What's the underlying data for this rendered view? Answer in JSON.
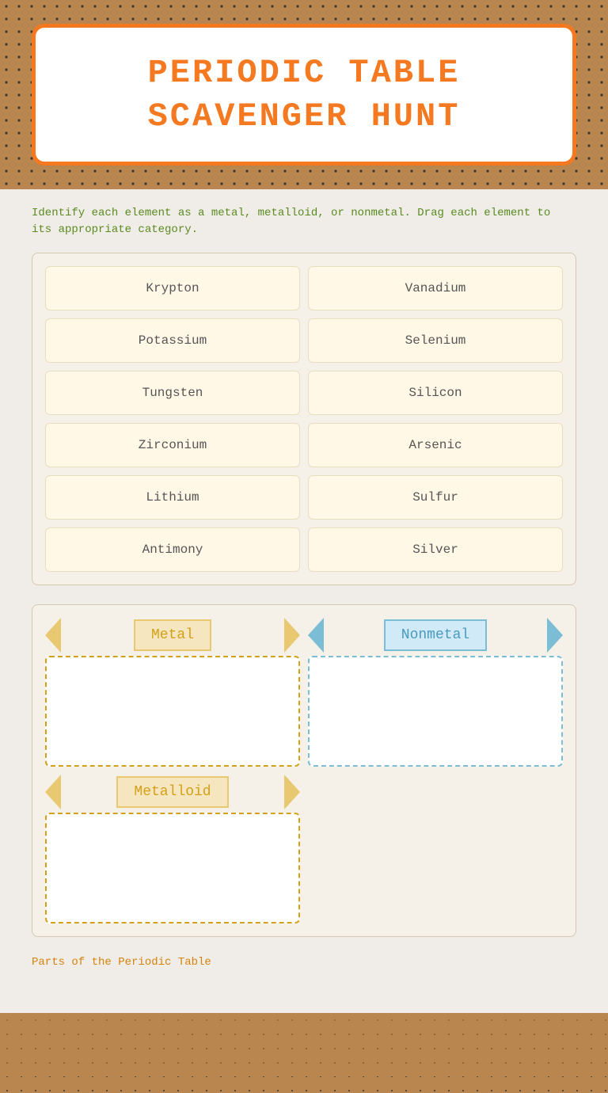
{
  "header": {
    "title_line1": "PERIODIC TABLE",
    "title_line2": "SCAVENGER HUNT"
  },
  "instructions": "Identify each element as a metal, metalloid, or nonmetal. Drag each element to its appropriate category.",
  "elements": [
    {
      "name": "Krypton",
      "col": 0
    },
    {
      "name": "Vanadium",
      "col": 1
    },
    {
      "name": "Potassium",
      "col": 0
    },
    {
      "name": "Selenium",
      "col": 1
    },
    {
      "name": "Tungsten",
      "col": 0
    },
    {
      "name": "Silicon",
      "col": 1
    },
    {
      "name": "Zirconium",
      "col": 0
    },
    {
      "name": "Arsenic",
      "col": 1
    },
    {
      "name": "Lithium",
      "col": 0
    },
    {
      "name": "Sulfur",
      "col": 1
    },
    {
      "name": "Antimony",
      "col": 0
    },
    {
      "name": "Silver",
      "col": 1
    }
  ],
  "categories": {
    "metal": {
      "label": "Metal",
      "type": "gold"
    },
    "nonmetal": {
      "label": "Nonmetal",
      "type": "blue"
    },
    "metalloid": {
      "label": "Metalloid",
      "type": "gold"
    }
  },
  "footer": {
    "link_text": "Parts of the Periodic Table"
  }
}
